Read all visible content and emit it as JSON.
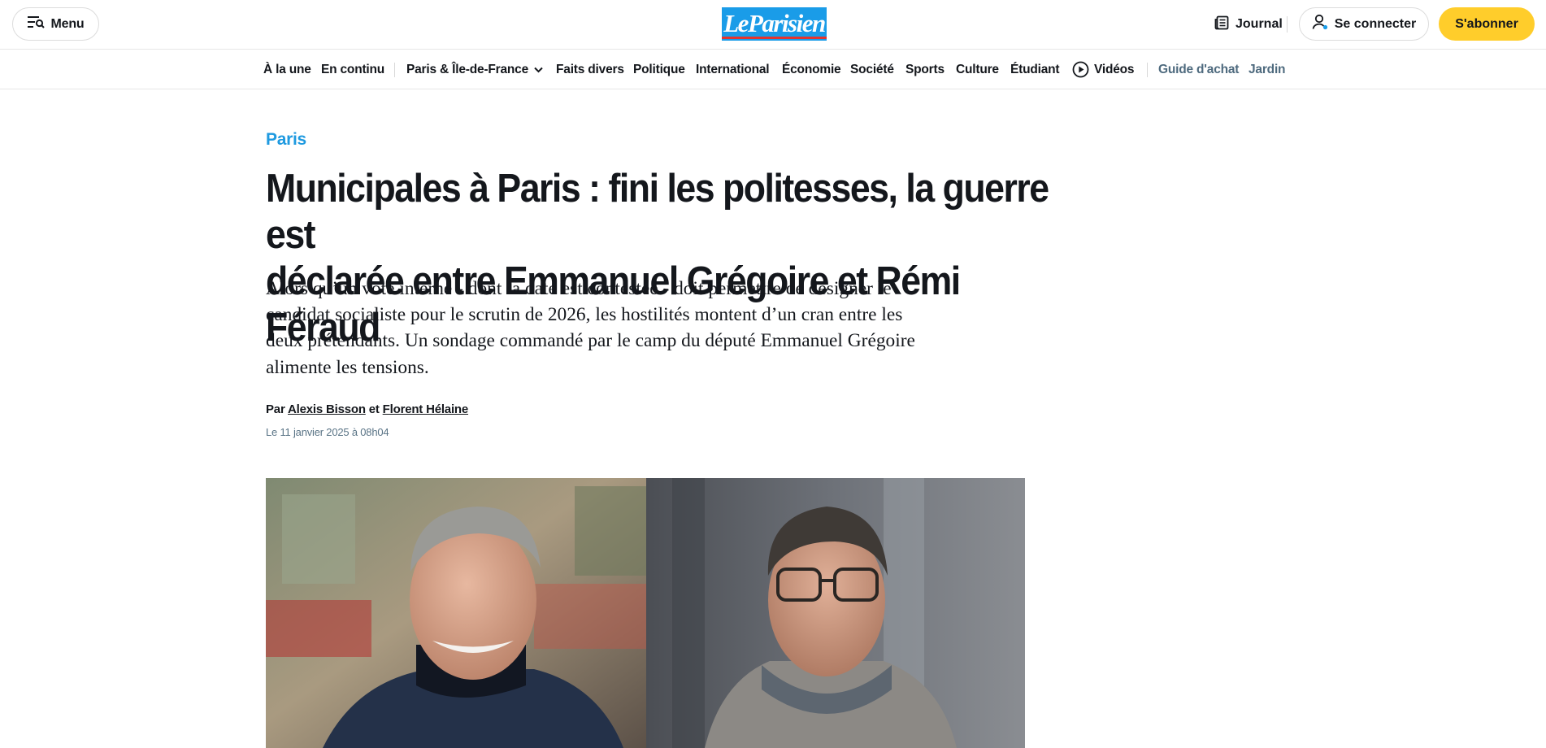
{
  "header": {
    "menu_label": "Menu",
    "logo_text": "LeParisien",
    "journal_label": "Journal",
    "login_label": "Se connecter",
    "subscribe_label": "S'abonner"
  },
  "nav": {
    "items": [
      {
        "label": "À la une"
      },
      {
        "label": "En continu"
      },
      {
        "label": "Paris & Île-de-France"
      },
      {
        "label": "Faits divers"
      },
      {
        "label": "Politique"
      },
      {
        "label": "International"
      },
      {
        "label": "Économie"
      },
      {
        "label": "Société"
      },
      {
        "label": "Sports"
      },
      {
        "label": "Culture"
      },
      {
        "label": "Étudiant"
      },
      {
        "label": "Vidéos"
      },
      {
        "label": "Guide d'achat"
      },
      {
        "label": "Jardin"
      }
    ]
  },
  "article": {
    "rubric": "Paris",
    "headline_line1": "Municipales à Paris : fini les politesses, la guerre est",
    "headline_line2": "déclarée entre Emmanuel Grégoire et Rémi Féraud",
    "lede_line1": "Alors qu’un vote interne - dont la date est contestée - doit permettre de désigner le",
    "lede_line2": "candidat socialiste pour le scrutin de 2026, les hostilités montent d’un cran entre les",
    "lede_line3": "deux prétendants. Un sondage commandé par le camp du député Emmanuel Grégoire",
    "lede_line4": "alimente les tensions.",
    "byline_prefix": "Par",
    "author1": "Alexis Bisson",
    "byline_and": "et",
    "author2": "Florent Hélaine",
    "date": "Le 11 janvier 2025 à 08h04"
  },
  "colors": {
    "brand_blue": "#1a9ce8",
    "subscribe_yellow": "#ffcd2b",
    "rubric_blue": "#1f9ae0"
  }
}
